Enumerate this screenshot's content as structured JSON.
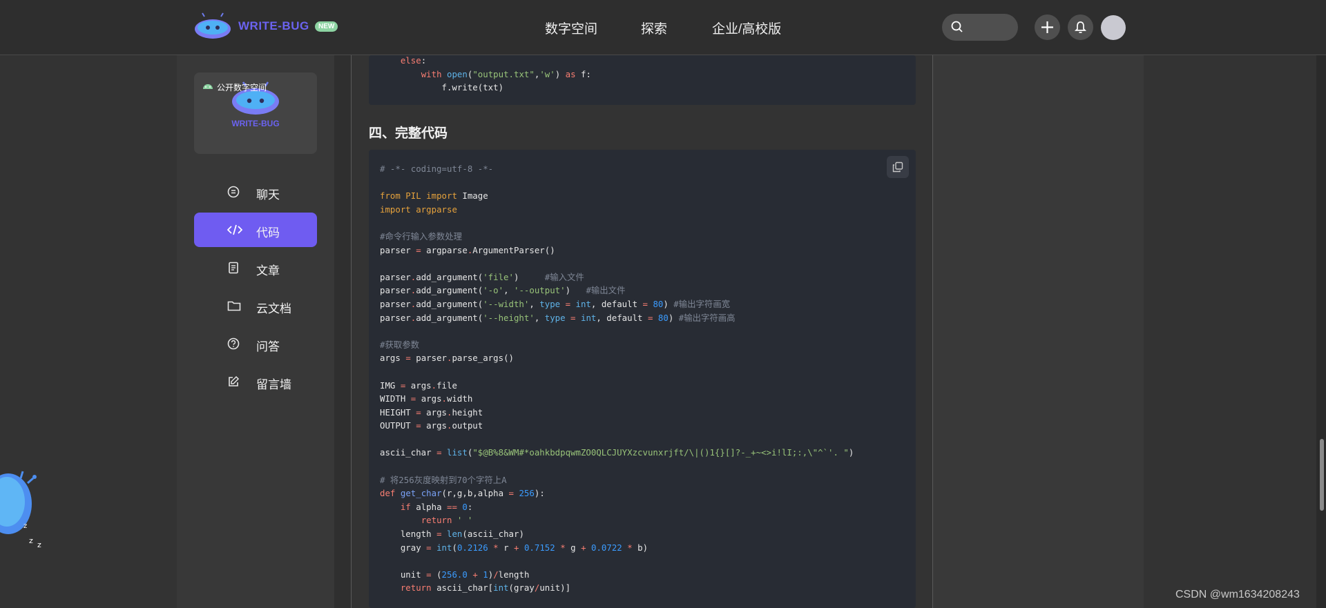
{
  "header": {
    "brand": "WRITE-BUG",
    "badge": "NEW",
    "nav": [
      "数字空间",
      "探索",
      "企业/高校版"
    ]
  },
  "sidebar": {
    "workspace": {
      "label": "公开数字空间",
      "brand": "WRITE-BUG"
    },
    "items": [
      {
        "label": "聊天",
        "icon": "chat-icon",
        "active": false
      },
      {
        "label": "代码",
        "icon": "code-icon",
        "active": true
      },
      {
        "label": "文章",
        "icon": "article-icon",
        "active": false
      },
      {
        "label": "云文档",
        "icon": "folder-icon",
        "active": false
      },
      {
        "label": "问答",
        "icon": "question-icon",
        "active": false
      },
      {
        "label": "留言墙",
        "icon": "edit-icon",
        "active": false
      }
    ]
  },
  "article": {
    "section_title": "四、完整代码",
    "snippet_top": [
      [
        [
          "    ",
          ""
        ],
        [
          "else",
          "kw"
        ],
        [
          ":",
          ""
        ]
      ],
      [
        [
          "        ",
          ""
        ],
        [
          "with",
          "kw"
        ],
        [
          " ",
          ""
        ],
        [
          "open",
          "bi"
        ],
        [
          "(",
          ""
        ],
        [
          "\"output.txt\"",
          "str"
        ],
        [
          ",",
          ""
        ],
        [
          "'w'",
          "str"
        ],
        [
          ") ",
          ""
        ],
        [
          "as",
          "kw"
        ],
        [
          " f:",
          ""
        ]
      ],
      [
        [
          "            f.write(txt)",
          ""
        ]
      ]
    ],
    "code_lines": [
      [
        [
          "# -*- coding=utf-8 -*-",
          "cm"
        ]
      ],
      [],
      [
        [
          "from",
          "kw2"
        ],
        [
          " PIL ",
          "kw2"
        ],
        [
          "import",
          "kw2"
        ],
        [
          " Image",
          ""
        ]
      ],
      [
        [
          "import",
          "kw2"
        ],
        [
          " argparse",
          "kw2"
        ]
      ],
      [],
      [
        [
          "#命令行输入参数处理",
          "cm"
        ]
      ],
      [
        [
          "parser ",
          ""
        ],
        [
          "=",
          "op"
        ],
        [
          " argparse",
          ""
        ],
        [
          ".",
          "op"
        ],
        [
          "ArgumentParser()",
          ""
        ]
      ],
      [],
      [
        [
          "parser",
          ""
        ],
        [
          ".",
          "op"
        ],
        [
          "add_argument(",
          ""
        ],
        [
          "'file'",
          "str"
        ],
        [
          ")     ",
          ""
        ],
        [
          "#输入文件",
          "cm"
        ]
      ],
      [
        [
          "parser",
          ""
        ],
        [
          ".",
          "op"
        ],
        [
          "add_argument(",
          ""
        ],
        [
          "'-o'",
          "str"
        ],
        [
          ", ",
          ""
        ],
        [
          "'--output'",
          "str"
        ],
        [
          ")   ",
          ""
        ],
        [
          "#输出文件",
          "cm"
        ]
      ],
      [
        [
          "parser",
          ""
        ],
        [
          ".",
          "op"
        ],
        [
          "add_argument(",
          ""
        ],
        [
          "'--width'",
          "str"
        ],
        [
          ", ",
          ""
        ],
        [
          "type",
          "bi"
        ],
        [
          " = ",
          "op"
        ],
        [
          "int",
          "bi"
        ],
        [
          ", default ",
          ""
        ],
        [
          "=",
          "op"
        ],
        [
          " ",
          ""
        ],
        [
          "80",
          "num"
        ],
        [
          ") ",
          ""
        ],
        [
          "#输出字符画宽",
          "cm"
        ]
      ],
      [
        [
          "parser",
          ""
        ],
        [
          ".",
          "op"
        ],
        [
          "add_argument(",
          ""
        ],
        [
          "'--height'",
          "str"
        ],
        [
          ", ",
          ""
        ],
        [
          "type",
          "bi"
        ],
        [
          " = ",
          "op"
        ],
        [
          "int",
          "bi"
        ],
        [
          ", default ",
          ""
        ],
        [
          "=",
          "op"
        ],
        [
          " ",
          ""
        ],
        [
          "80",
          "num"
        ],
        [
          ") ",
          ""
        ],
        [
          "#输出字符画高",
          "cm"
        ]
      ],
      [],
      [
        [
          "#获取参数",
          "cm"
        ]
      ],
      [
        [
          "args ",
          ""
        ],
        [
          "=",
          "op"
        ],
        [
          " parser",
          ""
        ],
        [
          ".",
          "op"
        ],
        [
          "parse_args()",
          ""
        ]
      ],
      [],
      [
        [
          "IMG ",
          ""
        ],
        [
          "=",
          "op"
        ],
        [
          " args",
          ""
        ],
        [
          ".",
          "op"
        ],
        [
          "file",
          ""
        ]
      ],
      [
        [
          "WIDTH ",
          ""
        ],
        [
          "=",
          "op"
        ],
        [
          " args",
          ""
        ],
        [
          ".",
          "op"
        ],
        [
          "width",
          ""
        ]
      ],
      [
        [
          "HEIGHT ",
          ""
        ],
        [
          "=",
          "op"
        ],
        [
          " args",
          ""
        ],
        [
          ".",
          "op"
        ],
        [
          "height",
          ""
        ]
      ],
      [
        [
          "OUTPUT ",
          ""
        ],
        [
          "=",
          "op"
        ],
        [
          " args",
          ""
        ],
        [
          ".",
          "op"
        ],
        [
          "output",
          ""
        ]
      ],
      [],
      [
        [
          "ascii_char ",
          ""
        ],
        [
          "=",
          "op"
        ],
        [
          " ",
          ""
        ],
        [
          "list",
          "bi"
        ],
        [
          "(",
          ""
        ],
        [
          "\"$@B%8&WM#*oahkbdpqwmZO0QLCJUYXzcvunxrjft/\\|()1{}[]?-_+~<>i!lI;:,\\\"^`'. \"",
          "str"
        ],
        [
          ")",
          ""
        ]
      ],
      [],
      [
        [
          "# 将256灰度映射到70个字符上A",
          "cm"
        ]
      ],
      [
        [
          "def",
          "kw"
        ],
        [
          " ",
          ""
        ],
        [
          "get_char",
          "fn"
        ],
        [
          "(r,g,b,alpha ",
          ""
        ],
        [
          "=",
          "op"
        ],
        [
          " ",
          ""
        ],
        [
          "256",
          "num"
        ],
        [
          "):",
          ""
        ]
      ],
      [
        [
          "    ",
          ""
        ],
        [
          "if",
          "kw"
        ],
        [
          " alpha ",
          ""
        ],
        [
          "==",
          "op"
        ],
        [
          " ",
          ""
        ],
        [
          "0",
          "num"
        ],
        [
          ":",
          ""
        ]
      ],
      [
        [
          "        ",
          ""
        ],
        [
          "return",
          "kw"
        ],
        [
          " ",
          ""
        ],
        [
          "' '",
          "str"
        ]
      ],
      [
        [
          "    length ",
          ""
        ],
        [
          "=",
          "op"
        ],
        [
          " ",
          ""
        ],
        [
          "len",
          "bi"
        ],
        [
          "(ascii_char)",
          ""
        ]
      ],
      [
        [
          "    gray ",
          ""
        ],
        [
          "=",
          "op"
        ],
        [
          " ",
          ""
        ],
        [
          "int",
          "bi"
        ],
        [
          "(",
          ""
        ],
        [
          "0.2126",
          "num"
        ],
        [
          " ",
          ""
        ],
        [
          "*",
          "op"
        ],
        [
          " r ",
          ""
        ],
        [
          "+",
          "op"
        ],
        [
          " ",
          ""
        ],
        [
          "0.7152",
          "num"
        ],
        [
          " ",
          ""
        ],
        [
          "*",
          "op"
        ],
        [
          " g ",
          ""
        ],
        [
          "+",
          "op"
        ],
        [
          " ",
          ""
        ],
        [
          "0.0722",
          "num"
        ],
        [
          " ",
          ""
        ],
        [
          "*",
          "op"
        ],
        [
          " b)",
          ""
        ]
      ],
      [],
      [
        [
          "    unit ",
          ""
        ],
        [
          "=",
          "op"
        ],
        [
          " (",
          ""
        ],
        [
          "256.0",
          "num"
        ],
        [
          " ",
          ""
        ],
        [
          "+",
          "op"
        ],
        [
          " ",
          ""
        ],
        [
          "1",
          "num"
        ],
        [
          ")",
          ""
        ],
        [
          "/",
          "op"
        ],
        [
          "length",
          ""
        ]
      ],
      [
        [
          "    ",
          ""
        ],
        [
          "return",
          "kw"
        ],
        [
          " ascii_char[",
          ""
        ],
        [
          "int",
          "bi"
        ],
        [
          "(gray",
          ""
        ],
        [
          "/",
          "op"
        ],
        [
          "unit)]",
          ""
        ]
      ]
    ]
  },
  "watermark": "CSDN @wm1634208243"
}
